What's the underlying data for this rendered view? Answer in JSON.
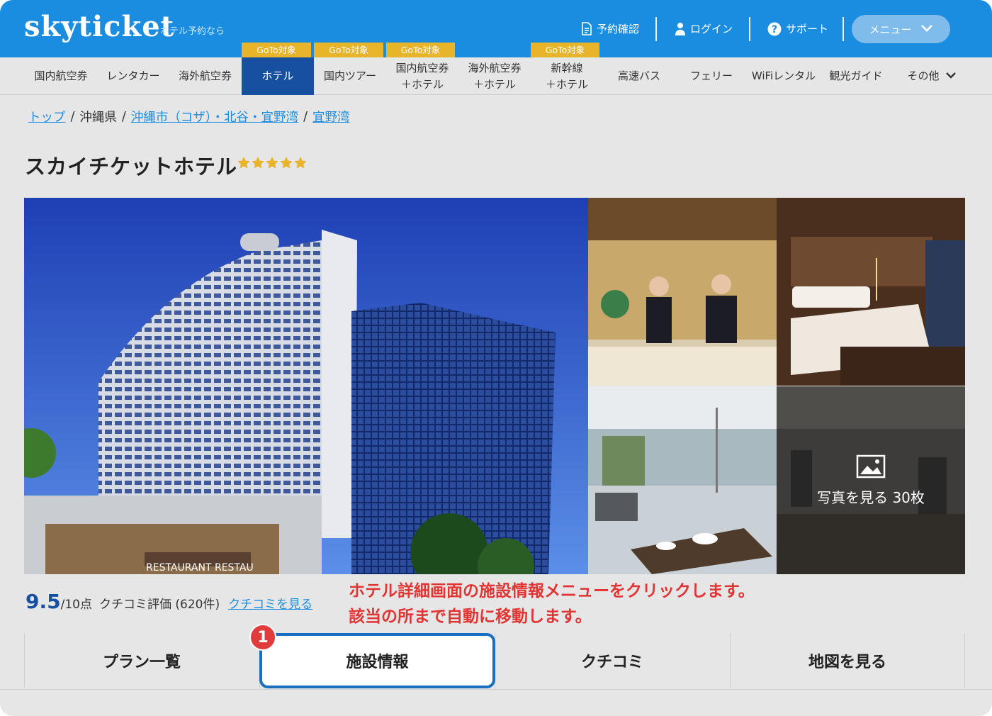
{
  "header": {
    "logo": "skyticket",
    "tagline": "ホテル予約なら",
    "links": [
      {
        "label": "予約確認",
        "icon": "document-icon"
      },
      {
        "label": "ログイン",
        "icon": "user-icon"
      },
      {
        "label": "サポート",
        "icon": "help-icon"
      }
    ],
    "menu_label": "メニュー"
  },
  "nav": {
    "items": [
      {
        "label": "国内航空券"
      },
      {
        "label": "レンタカー"
      },
      {
        "label": "海外航空券"
      },
      {
        "label": "ホテル",
        "badge": "GoTo対象"
      },
      {
        "label": "国内ツアー",
        "badge": "GoTo対象"
      },
      {
        "label": "国内航空券",
        "label2": "＋ホテル",
        "badge": "GoTo対象"
      },
      {
        "label": "海外航空券",
        "label2": "＋ホテル"
      },
      {
        "label": "新幹線",
        "label2": "＋ホテル",
        "badge": "GoTo対象"
      },
      {
        "label": "高速バス"
      },
      {
        "label": "フェリー"
      },
      {
        "label": "WiFiレンタル"
      },
      {
        "label": "観光ガイド"
      },
      {
        "label": "その他"
      }
    ]
  },
  "breadcrumb": {
    "top": "トップ",
    "prefecture": "沖縄県",
    "area": "沖縄市（コザ）・北谷・宜野湾",
    "city": "宜野湾",
    "sep": "/"
  },
  "hotel": {
    "name": "スカイチケットホテル",
    "stars": 5
  },
  "gallery": {
    "cta": "写真を見る 30枚"
  },
  "rating": {
    "score": "9.5",
    "out_of": "/10点",
    "label": "クチコミ評価 (620件)",
    "link": "クチコミを見る"
  },
  "annotation": {
    "line1": "ホテル詳細画面の施設情報メニューをクリックします。",
    "line2": "該当の所まで自動に移動します。",
    "step": "1"
  },
  "tabs": [
    {
      "label": "プラン一覧"
    },
    {
      "label": "施設情報"
    },
    {
      "label": "クチコミ"
    },
    {
      "label": "地図を見る"
    }
  ],
  "colors": {
    "brand_blue": "#1a8de0",
    "nav_active": "#1750a0",
    "goto_badge": "#e7b42a",
    "annotation_red": "#e33434"
  }
}
